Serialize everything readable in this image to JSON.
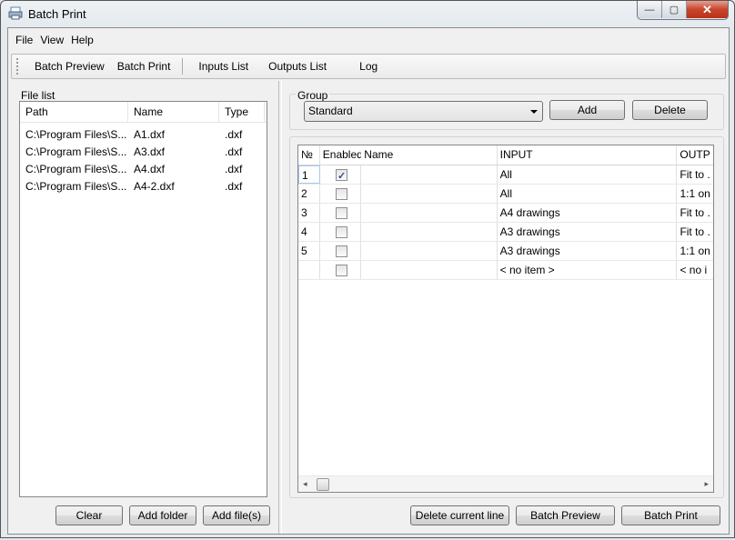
{
  "window": {
    "title": "Batch Print",
    "controls": {
      "minimize": "—",
      "maximize": "▢",
      "close": "✕"
    }
  },
  "menu": [
    "File",
    "View",
    "Help"
  ],
  "toolbar": {
    "items": [
      "Batch Preview",
      "Batch Print",
      "Inputs List",
      "Outputs List",
      "Log"
    ]
  },
  "file_list": {
    "label": "File list",
    "columns": [
      "Path",
      "Name",
      "Type"
    ],
    "rows": [
      {
        "path": "C:\\Program Files\\S...",
        "name": "A1.dxf",
        "type": ".dxf"
      },
      {
        "path": "C:\\Program Files\\S...",
        "name": "A3.dxf",
        "type": ".dxf"
      },
      {
        "path": "C:\\Program Files\\S...",
        "name": "A4.dxf",
        "type": ".dxf"
      },
      {
        "path": "C:\\Program Files\\S...",
        "name": "A4-2.dxf",
        "type": ".dxf"
      }
    ],
    "buttons": {
      "clear": "Clear",
      "add_folder": "Add folder",
      "add_files": "Add file(s)"
    }
  },
  "group": {
    "label": "Group",
    "selected": "Standard",
    "buttons": {
      "add": "Add",
      "delete": "Delete"
    }
  },
  "grid": {
    "columns": [
      "№",
      "Enabled",
      "Name",
      "INPUT",
      "OUTP"
    ],
    "rows": [
      {
        "num": "1",
        "enabled": true,
        "name": "",
        "input": "All",
        "output": "Fit to ."
      },
      {
        "num": "2",
        "enabled": false,
        "name": "",
        "input": "All",
        "output": "1:1 on"
      },
      {
        "num": "3",
        "enabled": false,
        "name": "",
        "input": "A4 drawings",
        "output": "Fit to ."
      },
      {
        "num": "4",
        "enabled": false,
        "name": "",
        "input": "A3 drawings",
        "output": "Fit to ."
      },
      {
        "num": "5",
        "enabled": false,
        "name": "",
        "input": "A3 drawings",
        "output": "1:1 on"
      },
      {
        "num": "",
        "enabled": false,
        "name": "",
        "input": "< no item >",
        "output": "< no i"
      }
    ]
  },
  "bottom_buttons": {
    "delete_line": "Delete current line",
    "batch_preview": "Batch Preview",
    "batch_print": "Batch Print"
  }
}
